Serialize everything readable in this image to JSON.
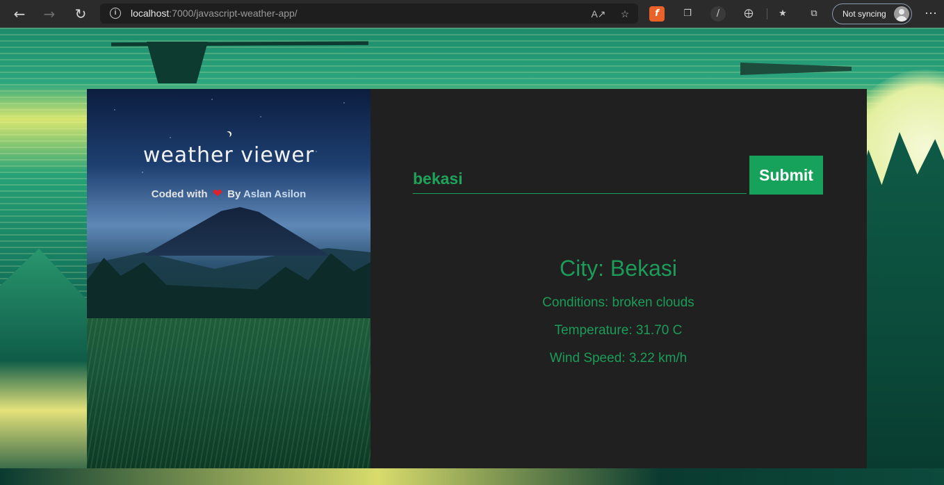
{
  "browser": {
    "url_host": "localhost",
    "url_path": ":7000/javascript-weather-app/",
    "sync_label": "Not syncing"
  },
  "app": {
    "title": "weather viewer",
    "credit_prefix": "Coded with",
    "credit_by": "By",
    "author": "Aslan Asilon",
    "search_value": "bekasi",
    "submit_label": "Submit",
    "city_line": "City: Bekasi",
    "conditions_line": "Conditions: broken clouds",
    "temperature_line": "Temperature: 31.70 C",
    "wind_line": "Wind Speed: 3.22 km/h"
  },
  "icons": {
    "back": "back-arrow-icon",
    "forward": "forward-arrow-icon",
    "refresh": "refresh-icon",
    "info": "site-info-icon",
    "read_aloud": "read-aloud-icon",
    "favorites_add": "add-favorite-icon",
    "heart": "heart-icon"
  },
  "colors": {
    "accent": "#17a25b",
    "result_text": "#1c9c58",
    "card_bg": "#202020"
  }
}
